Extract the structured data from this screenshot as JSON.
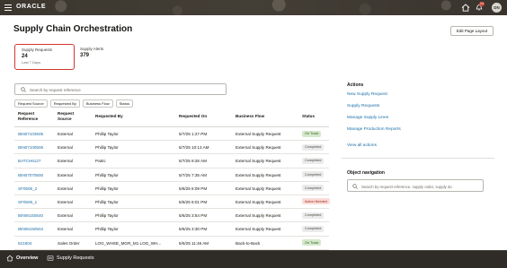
{
  "header": {
    "logo": "ORACLE",
    "notification_count": "14",
    "user_initials": "DN",
    "icons": [
      "hamburger-icon",
      "home-icon",
      "bell-icon"
    ]
  },
  "page": {
    "title": "Supply Chain Orchestration",
    "edit_button": "Edit Page Layout"
  },
  "tiles": {
    "supply_requests": {
      "label": "Supply Requests",
      "value": "24",
      "sub": "Last 7 Days"
    },
    "supply_alerts": {
      "label": "Supply Alerts",
      "value": "379"
    }
  },
  "search": {
    "placeholder": "Search by request reference"
  },
  "filters": [
    "Request Source",
    "Requested By",
    "Business Flow",
    "Status"
  ],
  "table": {
    "columns": {
      "request_reference": "Request Reference",
      "request_source": "Request Source",
      "requested_by": "Requested By",
      "requested_on": "Requested On",
      "business_flow": "Business Flow",
      "status": "Status"
    },
    "rows": [
      {
        "ref": "IBN07103505",
        "source": "External",
        "by": "Phillip Taylor",
        "on": "5/7/25 1:27 PM",
        "flow": "External Supply Request",
        "status": "On Track",
        "kind": "ontrack"
      },
      {
        "ref": "IBN07100506",
        "source": "External",
        "by": "Phillip Taylor",
        "on": "5/7/25 10:13 AM",
        "flow": "External Supply Request",
        "status": "Completed",
        "kind": "completed"
      },
      {
        "ref": "BATCH6127",
        "source": "External",
        "by": "Patric",
        "on": "5/7/25 9:26 AM",
        "flow": "External Supply Request",
        "status": "Completed",
        "kind": "completed"
      },
      {
        "ref": "IBN07070500",
        "source": "External",
        "by": "Phillip Taylor",
        "on": "5/7/25 7:35 AM",
        "flow": "External Supply Request",
        "status": "Completed",
        "kind": "completed"
      },
      {
        "ref": "SF0506_2",
        "source": "External",
        "by": "Phillip Taylor",
        "on": "5/6/25 6:09 PM",
        "flow": "External Supply Request",
        "status": "Completed",
        "kind": "completed"
      },
      {
        "ref": "SF0506_1",
        "source": "External",
        "by": "Phillip Taylor",
        "on": "5/6/25 6:01 PM",
        "flow": "External Supply Request",
        "status": "Action Needed",
        "kind": "action"
      },
      {
        "ref": "IBN06150540",
        "source": "External",
        "by": "Phillip Taylor",
        "on": "5/6/25 3:54 PM",
        "flow": "External Supply Request",
        "status": "Completed",
        "kind": "completed"
      },
      {
        "ref": "IBN06150504",
        "source": "External",
        "by": "Phillip Taylor",
        "on": "5/6/25 3:30 PM",
        "flow": "External Supply Request",
        "status": "Completed",
        "kind": "completed"
      },
      {
        "ref": "521804",
        "source": "Sales Order",
        "by": "LOG_WHSE_MGR_M1 LOG_WH...",
        "on": "5/6/25 11:46 AM",
        "flow": "Back-to-Back",
        "status": "On Track",
        "kind": "ontrack"
      }
    ]
  },
  "actions": {
    "title": "Actions",
    "links": [
      "New Supply Request",
      "Supply Requests",
      "Manage Supply Lines",
      "Manage Production Reports"
    ],
    "view_all": "View all actions"
  },
  "object_navigation": {
    "title": "Object navigation",
    "placeholder": "Search by request reference, supply order, supply do"
  },
  "bottom_nav": {
    "overview": "Overview",
    "supply_requests": "Supply Requests"
  },
  "colors": {
    "header_bg": "#3a3630",
    "bottom_bg": "#2f2c28",
    "link": "#1d6ea8",
    "tile_border": "#d0372f",
    "ontrack": "#d5e8cb",
    "action_needed": "#f9dcd8"
  }
}
